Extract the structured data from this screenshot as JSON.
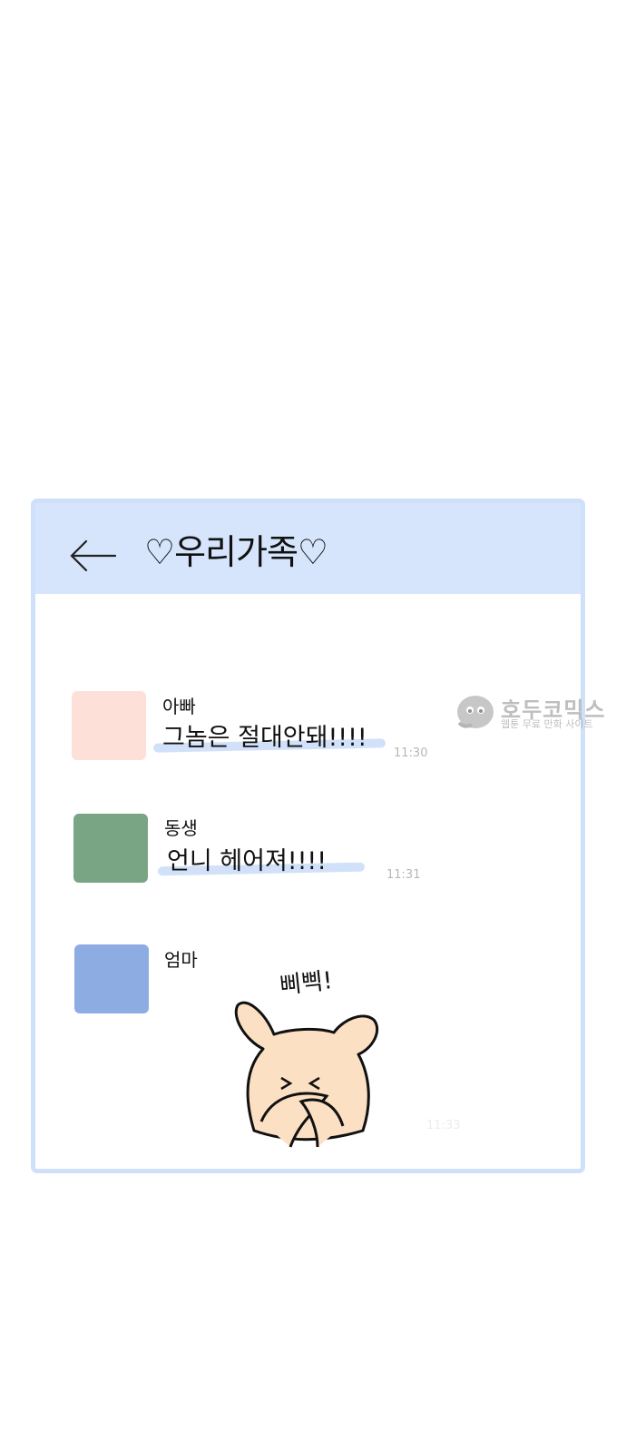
{
  "chat": {
    "title": "♡우리가족♡",
    "messages": [
      {
        "sender": "아빠",
        "text": "그놈은 절대안돼!!!!",
        "time": "11:30",
        "avatar_color": "#fde0d8"
      },
      {
        "sender": "동생",
        "text": "언니 헤어져!!!!",
        "time": "11:31",
        "avatar_color": "#7aa585"
      },
      {
        "sender": "엄마",
        "time": "11:33",
        "avatar_color": "#8dade2"
      }
    ],
    "sticker_sound": "삐삑!"
  },
  "watermark": {
    "title": "호두코믹스",
    "subtitle": "웹툰 무료 만화 사이트"
  },
  "colors": {
    "header_bg": "#d6e5fc",
    "frame_border": "#cfe0fb",
    "highlight": "#c8dcf8",
    "bear_fill": "#fce0c4"
  }
}
